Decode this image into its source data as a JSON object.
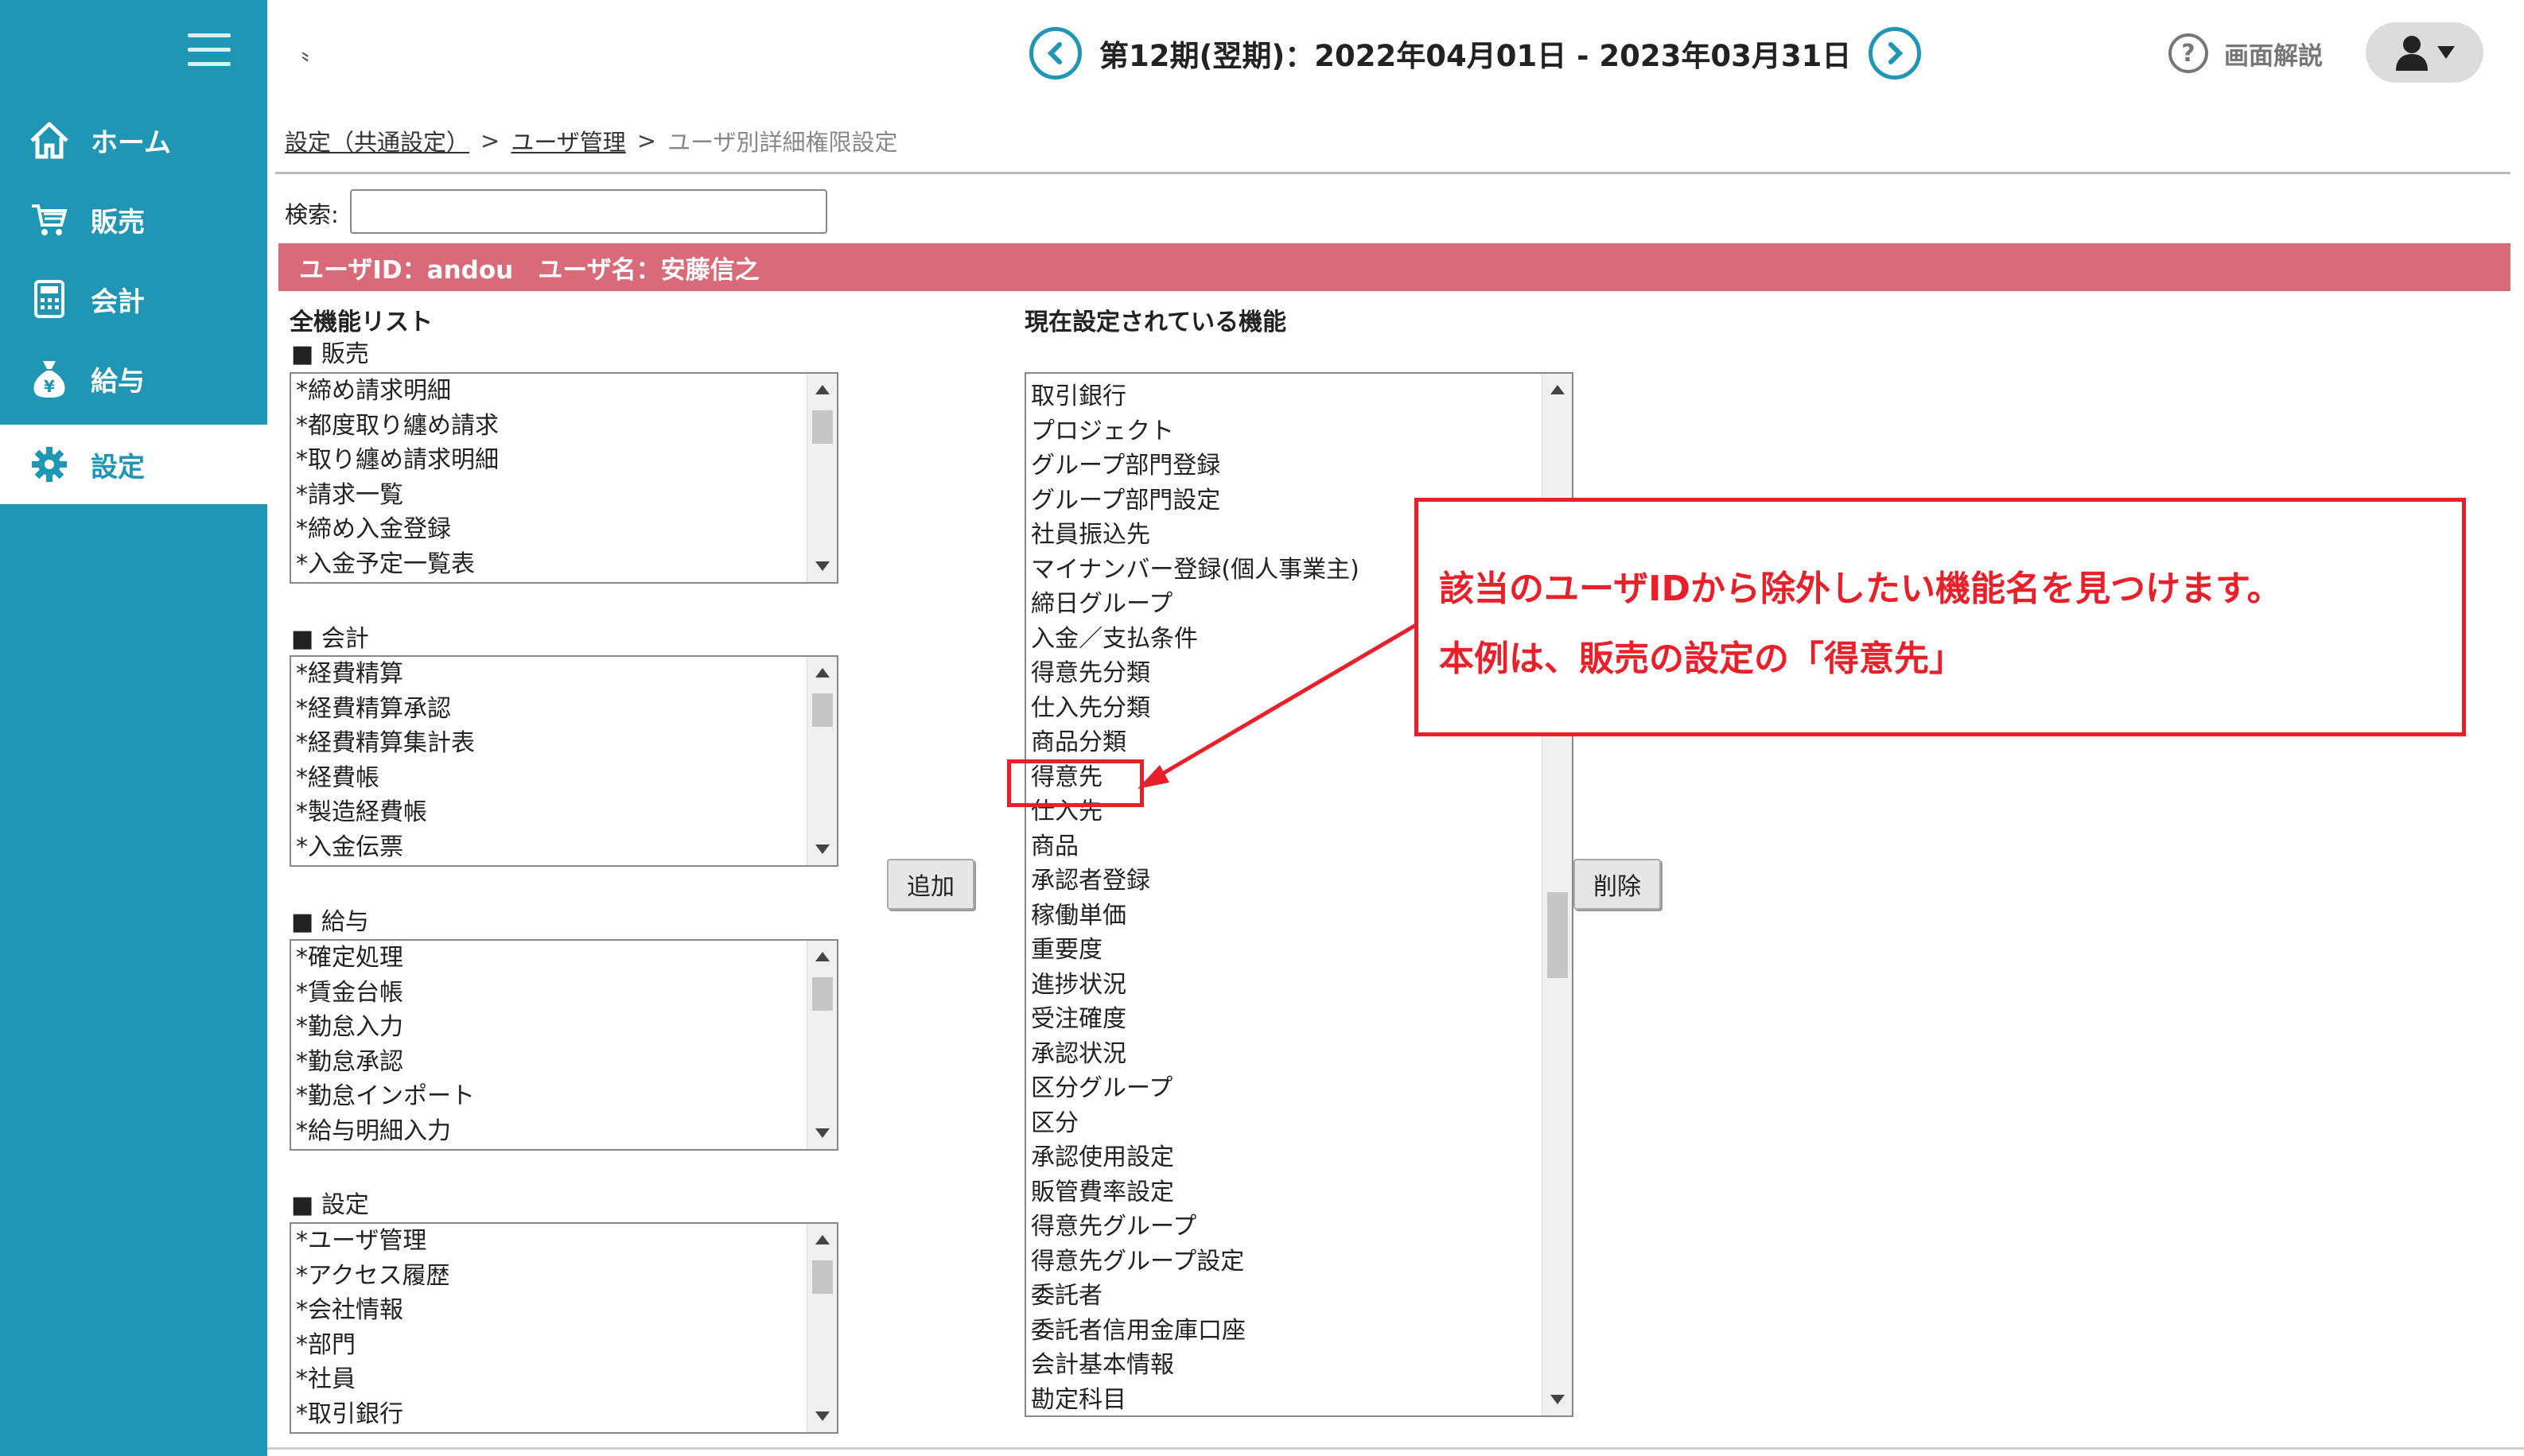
{
  "sidebar": {
    "items": [
      {
        "label": "ホーム",
        "icon": "home-icon"
      },
      {
        "label": "販売",
        "icon": "cart-icon"
      },
      {
        "label": "会計",
        "icon": "calculator-icon"
      },
      {
        "label": "給与",
        "icon": "money-bag-icon"
      },
      {
        "label": "設定",
        "icon": "gear-icon",
        "active": true
      }
    ]
  },
  "header": {
    "mark": "〟",
    "period": "第12期(翌期)：2022年04月01日 - 2023年03月31日",
    "help_label": "画面解説"
  },
  "breadcrumb": {
    "items": [
      "設定（共通設定）",
      "ユーザ管理"
    ],
    "current": "ユーザ別詳細権限設定",
    "sep": ">"
  },
  "search": {
    "label": "検索:",
    "value": ""
  },
  "userbar": {
    "text": "ユーザID：andou　ユーザ名：安藤信之"
  },
  "left": {
    "title": "全機能リスト",
    "groups": [
      {
        "title": "■ 販売",
        "items": [
          "*締め請求明細",
          "*都度取り纏め請求",
          "*取り纏め請求明細",
          "*請求一覧",
          "*締め入金登録",
          "*入金予定一覧表"
        ]
      },
      {
        "title": "■ 会計",
        "items": [
          "*経費精算",
          "*経費精算承認",
          "*経費精算集計表",
          "*経費帳",
          "*製造経費帳",
          "*入金伝票"
        ]
      },
      {
        "title": "■ 給与",
        "items": [
          "*確定処理",
          "*賃金台帳",
          "*勤怠入力",
          "*勤怠承認",
          "*勤怠インポート",
          "*給与明細入力"
        ]
      },
      {
        "title": "■ 設定",
        "items": [
          "*ユーザ管理",
          "*アクセス履歴",
          "*会社情報",
          "*部門",
          "*社員",
          "*取引銀行"
        ]
      }
    ]
  },
  "buttons": {
    "add": "追加",
    "remove": "削除"
  },
  "right": {
    "title": "現在設定されている機能",
    "items": [
      "取引銀行",
      "プロジェクト",
      "グループ部門登録",
      "グループ部門設定",
      "社員振込先",
      "マイナンバー登録(個人事業主)",
      "締日グループ",
      "入金／支払条件",
      "得意先分類",
      "仕入先分類",
      "商品分類",
      "得意先",
      "仕入先",
      "商品",
      "承認者登録",
      "稼働単価",
      "重要度",
      "進捗状況",
      "受注確度",
      "承認状況",
      "区分グループ",
      "区分",
      "承認使用設定",
      "販管費率設定",
      "得意先グループ",
      "得意先グループ設定",
      "委託者",
      "委託者信用金庫口座",
      "会計基本情報",
      "勘定科目"
    ]
  },
  "callout": {
    "line1": "該当のユーザIDから除外したい機能名を見つけます。",
    "line2": "本例は、販売の設定の「得意先」",
    "color": "#e8202a"
  },
  "colors": {
    "sidebar": "#1f96b4",
    "userbar": "#d96a79"
  }
}
